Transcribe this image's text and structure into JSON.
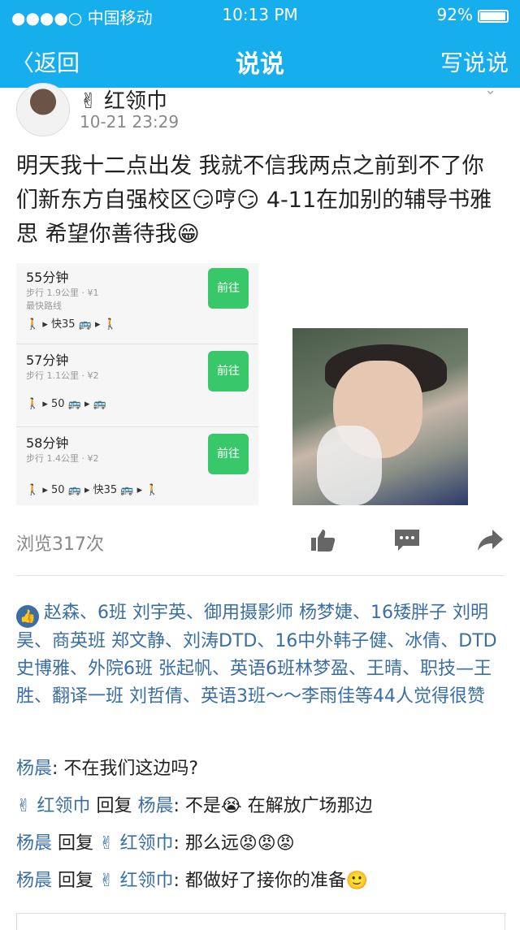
{
  "status_bar": {
    "carrier": "●●●●○ 中国移动",
    "time": "10:13 PM",
    "battery": "92%"
  },
  "nav": {
    "back": "返回",
    "title": "说说",
    "write": "写说说"
  },
  "post": {
    "user": "✌ 红领巾",
    "time": "10-21 23:29",
    "text": "明天我十二点出发 我就不信我两点之前到不了你们新东方自强校区😏哼😏 4-11在加别的辅导书雅思 希望你善待我😁",
    "routes": [
      {
        "mins": "55分钟",
        "sub": "步行 1.9公里 · ¥1",
        "fast": "最快路线",
        "line": "🚶 ▸ 快35 🚌 ▸ 🚶",
        "go": "前往"
      },
      {
        "mins": "57分钟",
        "sub": "步行 1.1公里 · ¥2",
        "fast": "",
        "line": "🚶 ▸ 50 🚌 ▸ 🚌",
        "go": "前往"
      },
      {
        "mins": "58分钟",
        "sub": "步行 1.4公里 · ¥2",
        "fast": "",
        "line": "🚶 ▸ 50 🚌 ▸ 快35 🚌 ▸ 🚶",
        "go": "前往"
      }
    ],
    "views": "浏览317次"
  },
  "likes": {
    "names": "赵森、6班  刘宇英、御用摄影师 杨梦婕、16矮胖子 刘明昊、商英班 郑文静、刘涛DTD、16中外韩子健、冰倩、DTD史博雅、外院6班 张起帆、英语6班林梦盈、王晴、职技—王胜、翻译一班 刘哲倩、英语3班～～李雨佳",
    "tail": "等44人觉得很赞"
  },
  "comments": [
    {
      "from": "杨晨",
      "reply": "",
      "to": "",
      "text": ": 不在我们这边吗?"
    },
    {
      "from": "✌ 红领巾",
      "reply": "回复",
      "to": "杨晨",
      "text": ": 不是😭 在解放广场那边"
    },
    {
      "from": "杨晨",
      "reply": "回复",
      "to": "✌ 红领巾",
      "text": ": 那么远😡😡😡"
    },
    {
      "from": "杨晨",
      "reply": "回复",
      "to": "✌ 红领巾",
      "text": ": 都做好了接你的准备🙂"
    }
  ],
  "colors": {
    "header": "#17aeee",
    "link": "#3a6ea5",
    "go_button": "#38c86a"
  }
}
